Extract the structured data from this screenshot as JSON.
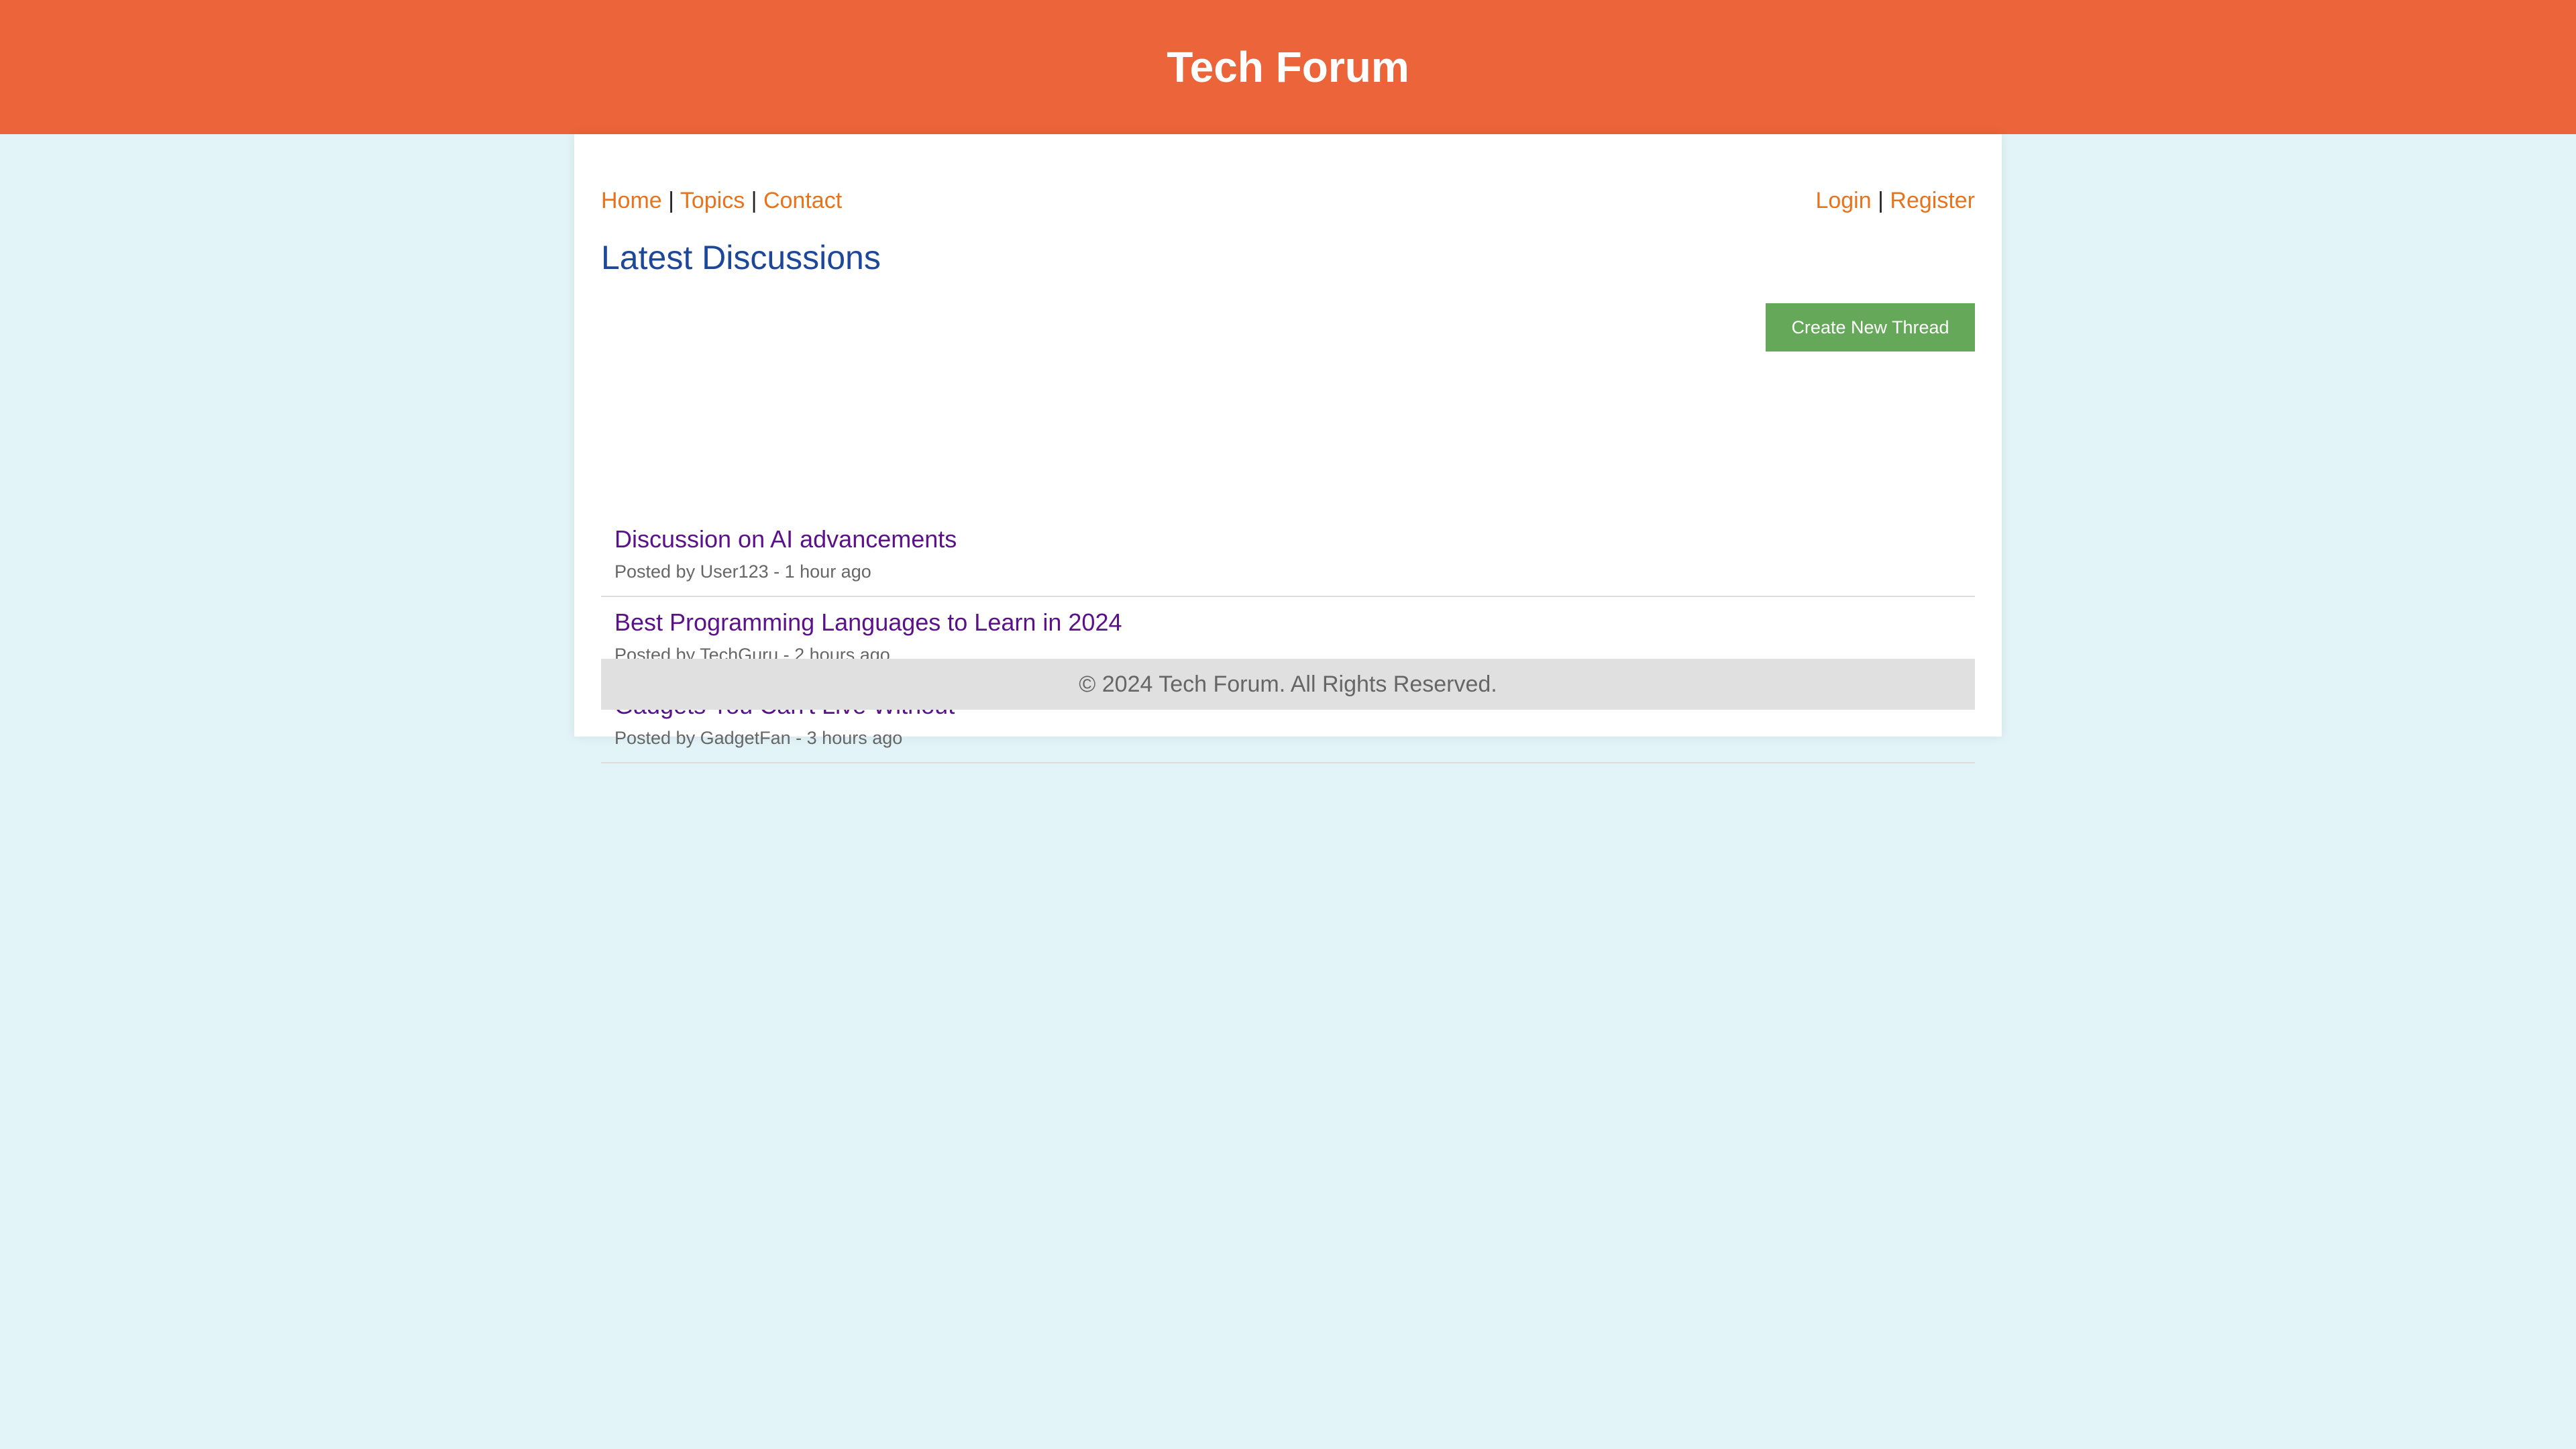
{
  "header": {
    "title": "Tech Forum"
  },
  "nav": {
    "left": [
      {
        "label": "Home"
      },
      {
        "label": "Topics"
      },
      {
        "label": "Contact"
      }
    ],
    "right": [
      {
        "label": "Login"
      },
      {
        "label": "Register"
      }
    ],
    "separator": "|"
  },
  "main": {
    "section_title": "Latest Discussions",
    "create_button_label": "Create New Thread",
    "threads": [
      {
        "title": "Discussion on AI advancements",
        "meta": "Posted by User123 - 1 hour ago"
      },
      {
        "title": "Best Programming Languages to Learn in 2024",
        "meta": "Posted by TechGuru - 2 hours ago"
      },
      {
        "title": "Gadgets You Can't Live Without",
        "meta": "Posted by GadgetFan - 3 hours ago"
      }
    ]
  },
  "footer": {
    "text": "© 2024 Tech Forum. All Rights Reserved."
  },
  "colors": {
    "header_bg": "#ec6439",
    "page_bg": "#e2f4f8",
    "link": "#e8731c",
    "section_title": "#1d4799",
    "thread_title": "#5a118a",
    "button_bg": "#66a85a",
    "footer_bg": "#e0e0e0"
  }
}
